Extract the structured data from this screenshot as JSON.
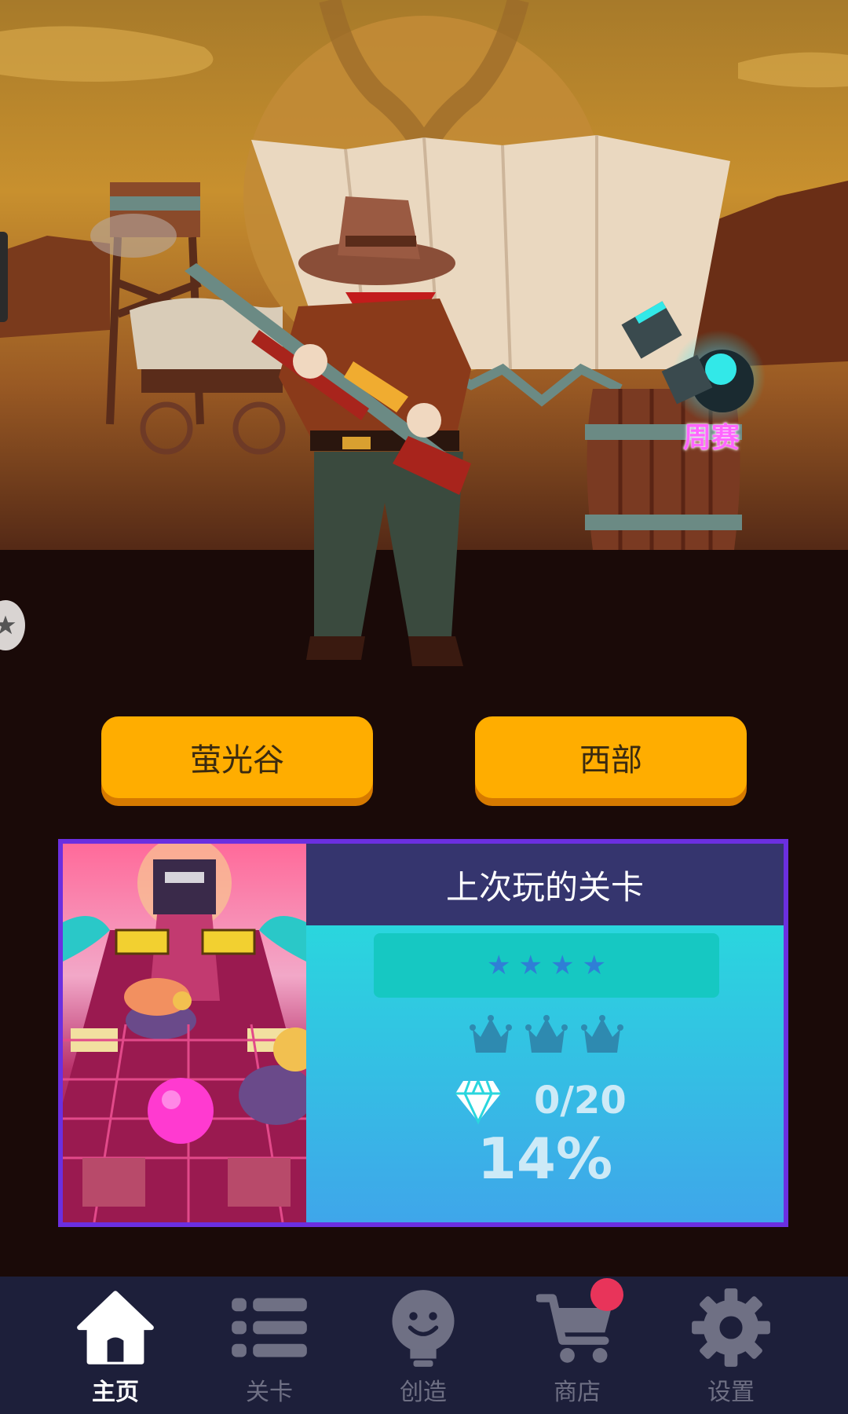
{
  "scene": {
    "weekly_label": "周赛"
  },
  "worlds": {
    "left_button": "萤光谷",
    "right_button": "西部"
  },
  "last_played": {
    "title": "上次玩的关卡",
    "stars": 4,
    "crowns": 3,
    "gems": "0/20",
    "progress": "14%"
  },
  "nav": {
    "items": [
      {
        "label": "主页",
        "icon": "home-icon",
        "active": true
      },
      {
        "label": "关卡",
        "icon": "list-icon",
        "active": false
      },
      {
        "label": "创造",
        "icon": "lightbulb-icon",
        "active": false
      },
      {
        "label": "商店",
        "icon": "cart-icon",
        "active": false,
        "notification": true
      },
      {
        "label": "设置",
        "icon": "gear-icon",
        "active": false
      }
    ]
  },
  "colors": {
    "accent_button": "#ffad00",
    "card_border": "#6b2fe0",
    "nav_bg": "#1d1f3a",
    "notification": "#e8345a"
  }
}
